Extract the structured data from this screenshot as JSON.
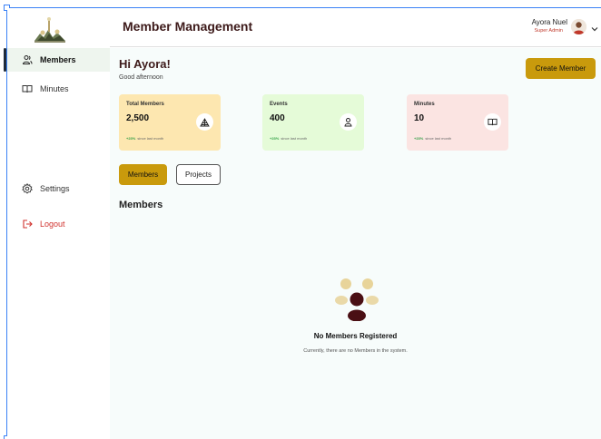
{
  "sidebar": {
    "items": [
      {
        "label": "Members",
        "icon": "users-icon",
        "active": true
      },
      {
        "label": "Minutes",
        "icon": "book-icon",
        "active": false
      },
      {
        "label": "Settings",
        "icon": "gear-icon",
        "active": false
      },
      {
        "label": "Logout",
        "icon": "logout-icon",
        "active": false
      }
    ]
  },
  "header": {
    "title": "Member Management",
    "user": {
      "name": "Ayora Nuel",
      "role": "Super Admin"
    }
  },
  "greeting": {
    "title": "Hi Ayora!",
    "subtitle": "Good afternoon"
  },
  "actions": {
    "create_member": "Create Member"
  },
  "stats": [
    {
      "label": "Total Members",
      "value": "2,500",
      "delta": "+23%",
      "delta_note": "since last month",
      "icon": "network-icon"
    },
    {
      "label": "Events",
      "value": "400",
      "delta": "+23%",
      "delta_note": "since last month",
      "icon": "person-icon"
    },
    {
      "label": "Minutes",
      "value": "10",
      "delta": "+23%",
      "delta_note": "since last month",
      "icon": "book-icon"
    }
  ],
  "tabs": [
    {
      "label": "Members",
      "selected": true
    },
    {
      "label": "Projects",
      "selected": false
    }
  ],
  "section": {
    "title": "Members"
  },
  "empty_state": {
    "title": "No Members Registered",
    "message": "Currently, there are no Members in the system."
  },
  "colors": {
    "accent": "#c99a0c",
    "brand_dark": "#3d1a1a",
    "logout": "#d0312d",
    "card_1": "#fde7b0",
    "card_2": "#e5fbd8",
    "card_3": "#fbe4e2",
    "positive": "#2f9e44"
  }
}
